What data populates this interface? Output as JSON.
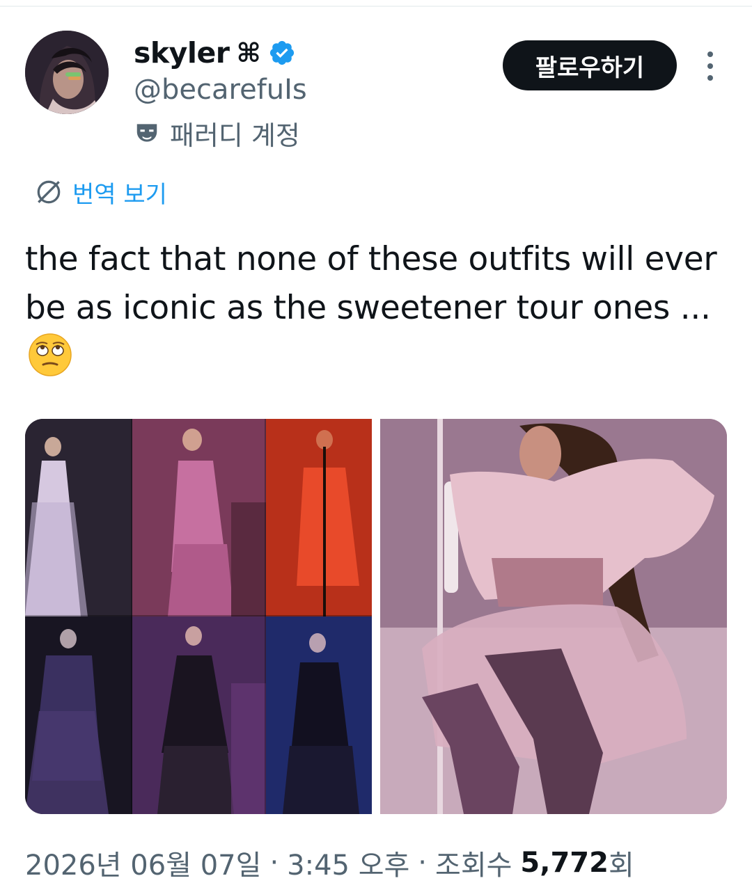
{
  "author": {
    "display_name": "skyler",
    "name_glyph": "⌘",
    "handle": "@becarefuIs",
    "parody_label": "패러디 계정",
    "verified": true
  },
  "actions": {
    "follow_label": "팔로우하기",
    "more_icon": "more-vertical-icon"
  },
  "translate": {
    "label": "번역 보기",
    "icon": "globe-icon"
  },
  "tweet": {
    "text": "the fact that none of these outfits will ever be as iconic as the sweetener tour ones ...",
    "emoji": "face-with-rolling-eyes-emoji"
  },
  "media": {
    "count": 2
  },
  "meta": {
    "date": "2026년 06월 07일",
    "separator": "·",
    "time": "3:45 오후",
    "views_label": "조회수",
    "views_count": "5,772",
    "views_suffix": "회"
  },
  "colors": {
    "text_primary": "#0f1419",
    "text_secondary": "#536471",
    "link": "#1d9bf0",
    "verified": "#1d9bf0",
    "button_bg": "#0f1419"
  }
}
